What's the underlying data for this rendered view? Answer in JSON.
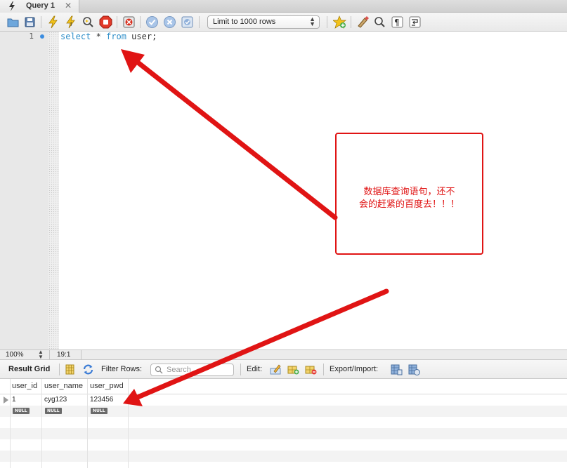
{
  "tab": {
    "title": "Query 1",
    "close_glyph": "✕"
  },
  "toolbar": {
    "icons": [
      "open-folder-icon",
      "save-icon",
      "execute-icon",
      "execute-current-icon",
      "explain-icon",
      "stop-icon",
      "toggle-error-icon",
      "commit-icon",
      "rollback-icon",
      "autocommit-icon",
      "add-snippet-icon",
      "beautify-icon",
      "find-icon",
      "invisible-chars-icon",
      "wrap-lines-icon"
    ],
    "limit_label": "Limit to 1000 rows"
  },
  "editor": {
    "line_number": "1",
    "code": {
      "kw1": "select",
      "rest1": " * ",
      "kw2": "from",
      "rest2": " user;"
    }
  },
  "status": {
    "zoom": "100%",
    "cursor": "19:1"
  },
  "result_toolbar": {
    "title": "Result Grid",
    "filter_label": "Filter Rows:",
    "filter_placeholder": "Search",
    "edit_label": "Edit:",
    "export_label": "Export/Import:"
  },
  "grid": {
    "columns": [
      "user_id",
      "user_name",
      "user_pwd"
    ],
    "rows": [
      [
        "1",
        "cyg123",
        "123456"
      ],
      [
        "NULL",
        "NULL",
        "NULL"
      ]
    ]
  },
  "annotation": {
    "line1": "数据库查询语句，还不",
    "line2": "会的赶紧的百度去！！！",
    "color": "#e01414"
  },
  "colors": {
    "keyword": "#2f8fc9",
    "accent": "#3b8de0"
  }
}
